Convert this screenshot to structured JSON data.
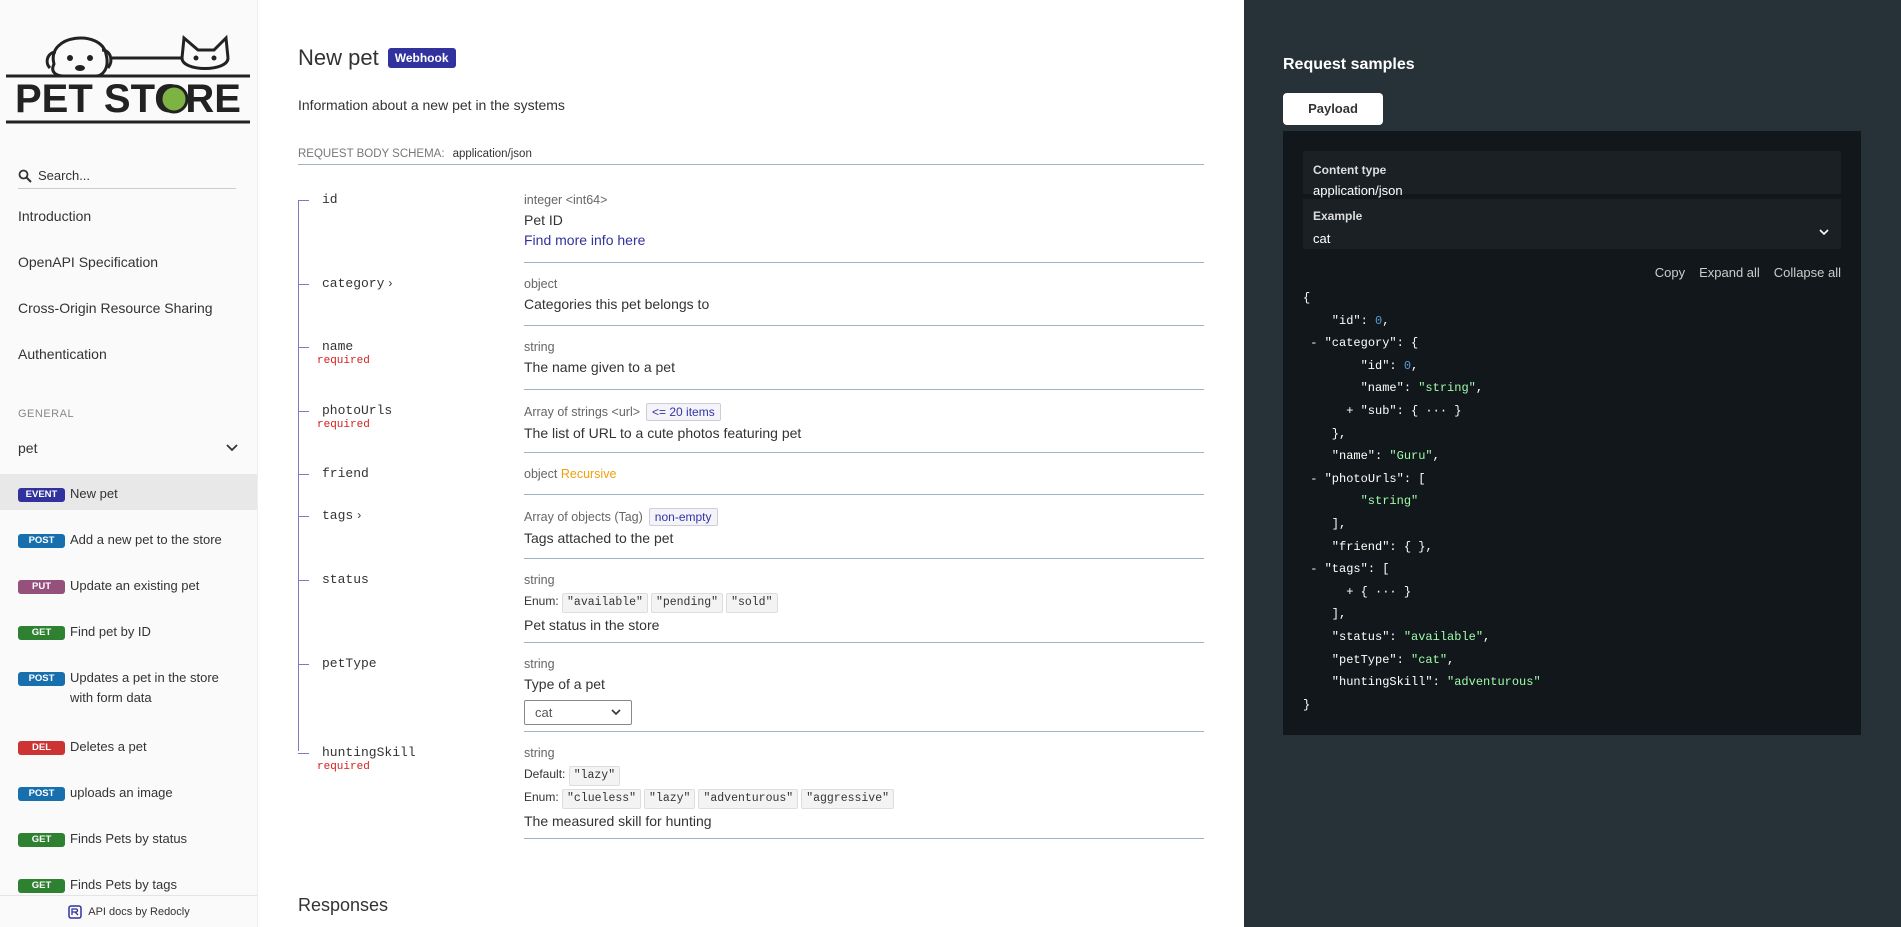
{
  "sidebar": {
    "logo_text": "PET STORE",
    "search_placeholder": "Search...",
    "intro_links": [
      "Introduction",
      "OpenAPI Specification",
      "Cross-Origin Resource Sharing",
      "Authentication"
    ],
    "section_label": "GENERAL",
    "group_label": "pet",
    "operations": [
      {
        "badge": "EVENT",
        "color": "#32329f",
        "label": "New pet",
        "active": true
      },
      {
        "badge": "POST",
        "color": "#186fae",
        "label": "Add a new pet to the store"
      },
      {
        "badge": "PUT",
        "color": "#95507c",
        "label": "Update an existing pet"
      },
      {
        "badge": "GET",
        "color": "#2f8132",
        "label": "Find pet by ID"
      },
      {
        "badge": "POST",
        "color": "#186fae",
        "label": "Updates a pet in the store with form data"
      },
      {
        "badge": "DEL",
        "color": "#cc3333",
        "label": "Deletes a pet"
      },
      {
        "badge": "POST",
        "color": "#186fae",
        "label": "uploads an image"
      },
      {
        "badge": "GET",
        "color": "#2f8132",
        "label": "Finds Pets by status"
      },
      {
        "badge": "GET",
        "color": "#2f8132",
        "label": "Finds Pets by tags"
      }
    ],
    "footer": "API docs by Redocly"
  },
  "main": {
    "title": "New pet",
    "badge": "Webhook",
    "description": "Information about a new pet in the systems",
    "schema_label": "REQUEST BODY SCHEMA:",
    "content_type": "application/json",
    "props": {
      "id": {
        "name": "id",
        "type": "integer <int64>",
        "desc": "Pet ID",
        "link": "Find more info here"
      },
      "category": {
        "name": "category",
        "chev": "›",
        "type": "object",
        "desc": "Categories this pet belongs to"
      },
      "name": {
        "name": "name",
        "required": "required",
        "type": "string",
        "desc": "The name given to a pet"
      },
      "photoUrls": {
        "name": "photoUrls",
        "required": "required",
        "type": "Array of strings <url>",
        "constraint": "<= 20 items",
        "desc": "The list of URL to a cute photos featuring pet"
      },
      "friend": {
        "name": "friend",
        "type": "object",
        "recursive": "Recursive"
      },
      "tags": {
        "name": "tags",
        "chev": "›",
        "type": "Array of objects (Tag)",
        "constraint": "non-empty",
        "desc": "Tags attached to the pet"
      },
      "status": {
        "name": "status",
        "type": "string",
        "enum_label": "Enum:",
        "enum": [
          "\"available\"",
          "\"pending\"",
          "\"sold\""
        ],
        "desc": "Pet status in the store"
      },
      "petType": {
        "name": "petType",
        "type": "string",
        "desc": "Type of a pet",
        "select_value": "cat"
      },
      "huntingSkill": {
        "name": "huntingSkill",
        "required": "required",
        "type": "string",
        "default_label": "Default:",
        "default": "\"lazy\"",
        "enum_label": "Enum:",
        "enum": [
          "\"clueless\"",
          "\"lazy\"",
          "\"adventurous\"",
          "\"aggressive\""
        ],
        "desc": "The measured skill for hunting"
      }
    },
    "responses_heading": "Responses"
  },
  "right": {
    "title": "Request samples",
    "tab": "Payload",
    "content_type_label": "Content type",
    "content_type_value": "application/json",
    "example_label": "Example",
    "example_value": "cat",
    "actions": [
      "Copy",
      "Expand all",
      "Collapse all"
    ],
    "json_sample": {
      "id": "0",
      "category_id": "0",
      "category_name": "\"string\"",
      "sub_collapsed": "{ ··· }",
      "name": "\"Guru\"",
      "photoUrl": "\"string\"",
      "friend": "{ }",
      "tags_collapsed": "{ ··· }",
      "status": "\"available\"",
      "petType": "\"cat\"",
      "huntingSkill": "\"adventurous\""
    }
  }
}
